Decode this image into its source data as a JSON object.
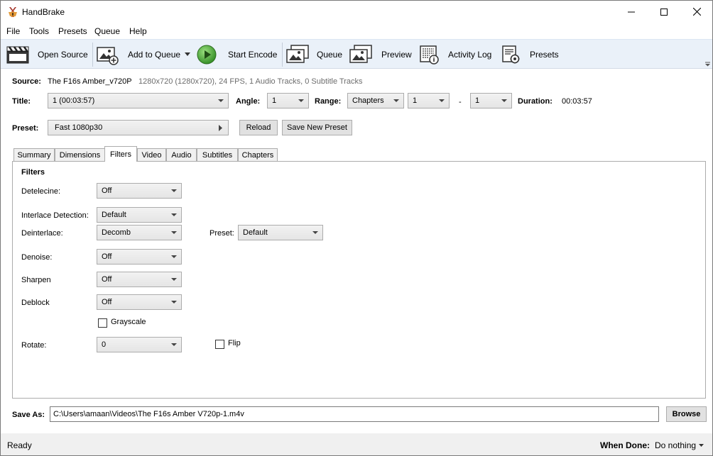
{
  "window": {
    "title": "HandBrake"
  },
  "menu": [
    "File",
    "Tools",
    "Presets",
    "Queue",
    "Help"
  ],
  "toolbar": {
    "open_source": "Open Source",
    "add_to_queue": "Add to Queue",
    "start_encode": "Start Encode",
    "queue": "Queue",
    "preview": "Preview",
    "activity_log": "Activity Log",
    "presets": "Presets"
  },
  "source": {
    "label": "Source:",
    "name": "The F16s  Amber_v720P",
    "info": "1280x720 (1280x720), 24 FPS, 1 Audio Tracks, 0 Subtitle Tracks"
  },
  "title_row": {
    "title_label": "Title:",
    "title_value": "1  (00:03:57)",
    "angle_label": "Angle:",
    "angle_value": "1",
    "range_label": "Range:",
    "range_type": "Chapters",
    "range_start": "1",
    "range_dash": "-",
    "range_end": "1",
    "duration_label": "Duration:",
    "duration_value": "00:03:57"
  },
  "preset_row": {
    "label": "Preset:",
    "value": "Fast 1080p30",
    "reload": "Reload",
    "save_new": "Save New Preset"
  },
  "tabs": [
    "Summary",
    "Dimensions",
    "Filters",
    "Video",
    "Audio",
    "Subtitles",
    "Chapters"
  ],
  "active_tab": "Filters",
  "filters": {
    "heading": "Filters",
    "detelecine_label": "Detelecine:",
    "detelecine_value": "Off",
    "interlace_label": "Interlace Detection:",
    "interlace_value": "Default",
    "deinterlace_label": "Deinterlace:",
    "deinterlace_value": "Decomb",
    "preset_label": "Preset:",
    "preset_value": "Default",
    "denoise_label": "Denoise:",
    "denoise_value": "Off",
    "sharpen_label": "Sharpen",
    "sharpen_value": "Off",
    "deblock_label": "Deblock",
    "deblock_value": "Off",
    "grayscale_label": "Grayscale",
    "grayscale_checked": false,
    "rotate_label": "Rotate:",
    "rotate_value": "0",
    "flip_label": "Flip",
    "flip_checked": false
  },
  "save_as": {
    "label": "Save As:",
    "path": "C:\\Users\\amaan\\Videos\\The F16s  Amber V720p-1.m4v",
    "browse": "Browse"
  },
  "status": {
    "text": "Ready",
    "when_done_label": "When Done:",
    "when_done_value": "Do nothing"
  },
  "colors": {
    "toolbar_bg": "#eaf1f9",
    "start_encode_green": "#4caf3a",
    "status_bg": "#f0f0f0"
  }
}
